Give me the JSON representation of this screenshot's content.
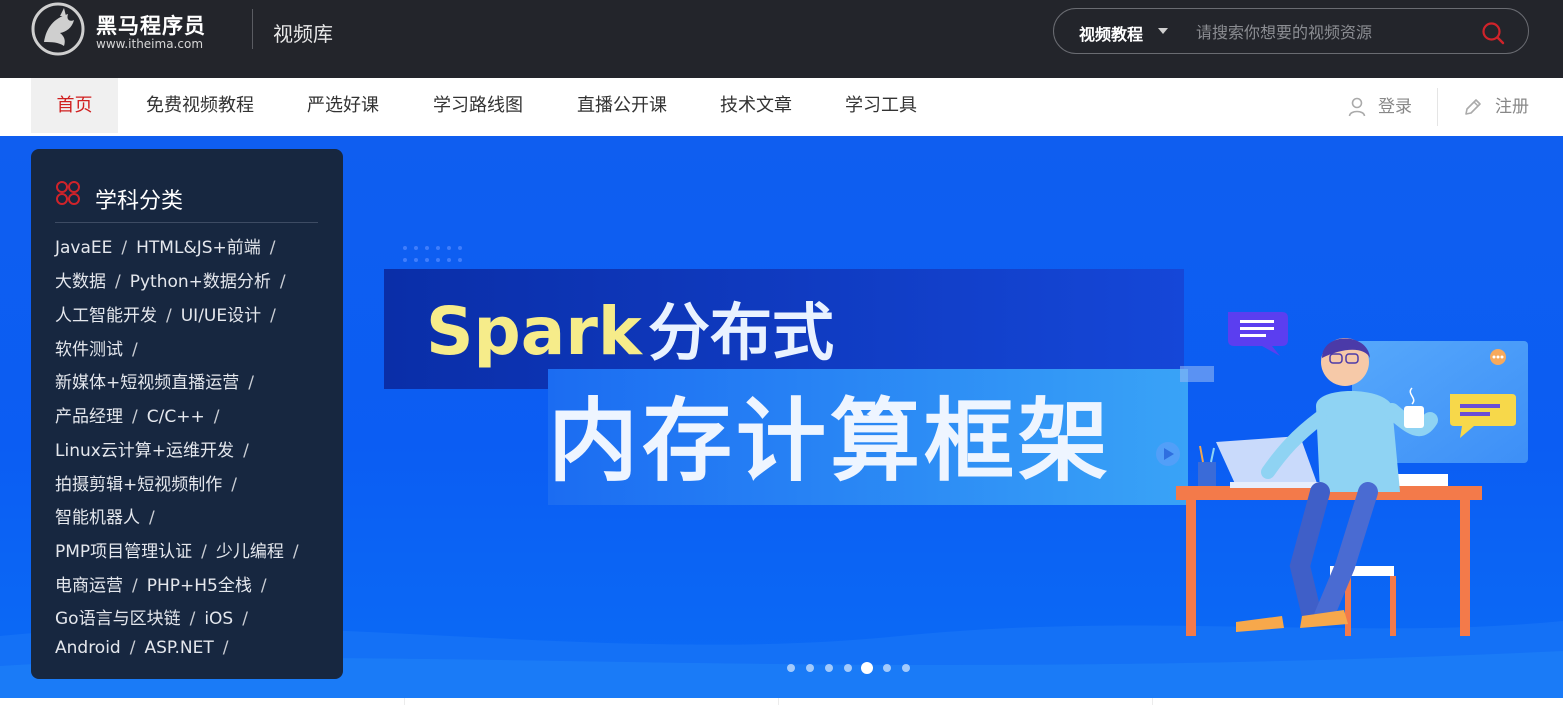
{
  "header": {
    "logo_name": "黑马程序员",
    "logo_url": "www.itheima.com",
    "section_title": "视频库",
    "search_category": "视频教程",
    "search_placeholder": "请搜索你想要的视频资源"
  },
  "nav": {
    "items": [
      {
        "label": "首页",
        "active": true
      },
      {
        "label": "免费视频教程"
      },
      {
        "label": "严选好课"
      },
      {
        "label": "学习路线图"
      },
      {
        "label": "直播公开课"
      },
      {
        "label": "技术文章"
      },
      {
        "label": "学习工具"
      }
    ],
    "login_label": "登录",
    "register_label": "注册"
  },
  "banner": {
    "headline_latin": "Spark",
    "headline_cn": "分布式",
    "subline": "内存计算框架",
    "slide_count": 7,
    "active_slide": 5
  },
  "categories": {
    "title": "学科分类",
    "rows": [
      [
        "JavaEE",
        "HTML&JS+前端"
      ],
      [
        "大数据",
        "Python+数据分析"
      ],
      [
        "人工智能开发",
        "UI/UE设计"
      ],
      [
        "软件测试"
      ],
      [
        "新媒体+短视频直播运营"
      ],
      [
        "产品经理",
        "C/C++"
      ],
      [
        "Linux云计算+运维开发"
      ],
      [
        "拍摄剪辑+短视频制作"
      ],
      [
        "智能机器人"
      ],
      [
        "PMP项目管理认证",
        "少儿编程"
      ],
      [
        "电商运营",
        "PHP+H5全栈"
      ],
      [
        "Go语言与区块链",
        "iOS"
      ],
      [
        "Android",
        "ASP.NET"
      ]
    ],
    "separator": "/"
  },
  "colors": {
    "header_bg": "#23252b",
    "accent_red": "#d01f1f",
    "banner_blue": "#0b5df3",
    "panel_bg": "#172740",
    "headline_yellow": "#f6ec8a"
  }
}
